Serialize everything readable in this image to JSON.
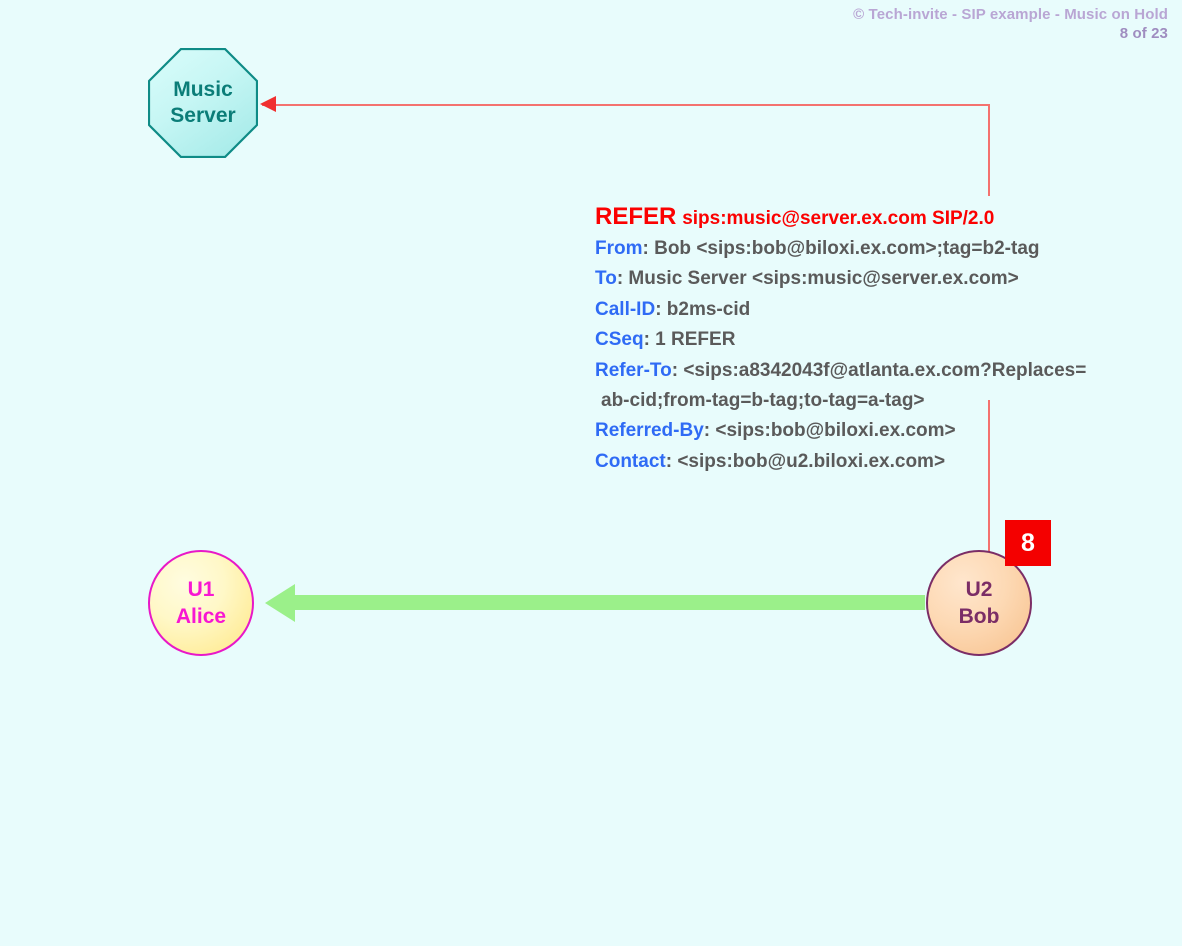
{
  "header": {
    "line1": "© Tech-invite - SIP example - Music on Hold",
    "line2": "8 of 23"
  },
  "nodes": {
    "music_server": {
      "shape": "octagon",
      "line1": "Music",
      "line2": "Server",
      "border_color": "#0f8b86",
      "text_color": "#0b7d78"
    },
    "alice": {
      "shape": "circle",
      "line1": "U1",
      "line2": "Alice",
      "border_color": "#e818c8",
      "text_color": "#f718d2"
    },
    "bob": {
      "shape": "circle",
      "line1": "U2",
      "line2": "Bob",
      "border_color": "#7b2d66",
      "text_color": "#7b2d66"
    }
  },
  "badge": {
    "step": "8",
    "background": "#f40000",
    "color": "#ffffff"
  },
  "arrows": {
    "signalling": {
      "color": "#f4726f",
      "arrowhead_color": "#f03030",
      "direction": "bob-to-music-server",
      "style": "thin-line"
    },
    "media": {
      "color": "#9bf08a",
      "direction": "bob-to-alice",
      "style": "thick-block-arrow"
    }
  },
  "sip_message": {
    "request_line": {
      "method": "REFER",
      "request_uri": "sips:music@server.ex.com SIP/2.0",
      "color": "#fb0101"
    },
    "header_name_color": "#2f6bf5",
    "header_value_color": "#5a5a5a",
    "headers": [
      {
        "name": "From",
        "value": ": Bob <sips:bob@biloxi.ex.com>;tag=b2-tag"
      },
      {
        "name": "To",
        "value": ": Music Server <sips:music@server.ex.com>"
      },
      {
        "name": "Call-ID",
        "value": ": b2ms-cid"
      },
      {
        "name": "CSeq",
        "value": ": 1 REFER"
      },
      {
        "name": "Refer-To",
        "value": ": <sips:a8342043f@atlanta.ex.com?Replaces="
      }
    ],
    "continuation_line": " ab-cid;from-tag=b-tag;to-tag=a-tag>",
    "headers_after": [
      {
        "name": "Referred-By",
        "value": ": <sips:bob@biloxi.ex.com>"
      },
      {
        "name": "Contact",
        "value": ": <sips:bob@u2.biloxi.ex.com>"
      }
    ]
  },
  "colors": {
    "background": "#e8fcfc"
  }
}
